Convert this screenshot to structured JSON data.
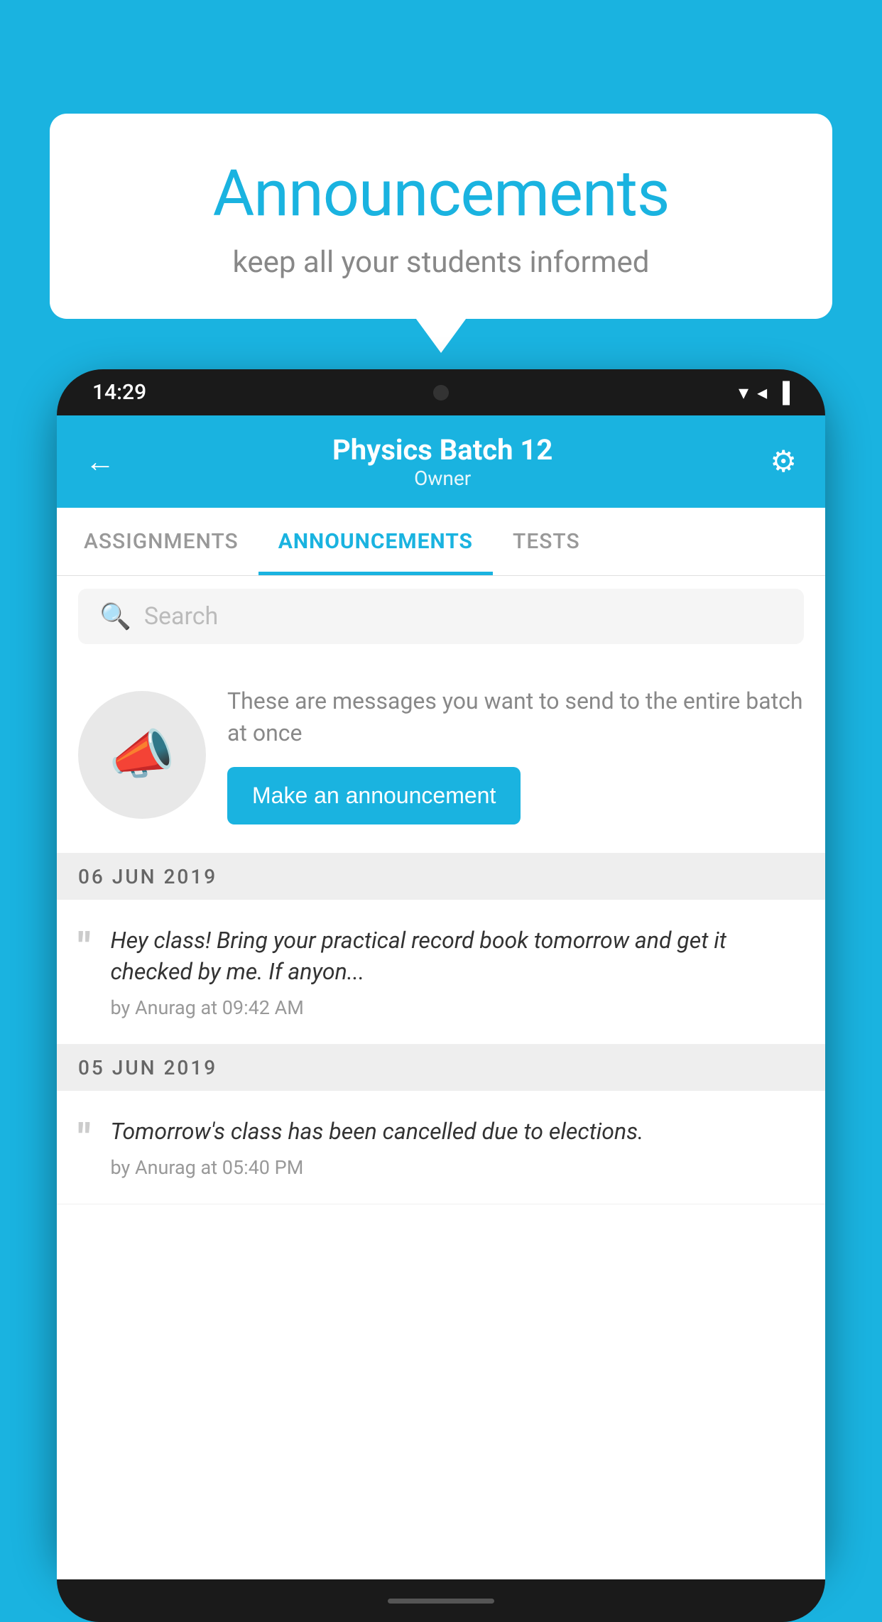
{
  "background_color": "#1ab3e0",
  "speech_bubble": {
    "title": "Announcements",
    "subtitle": "keep all your students informed"
  },
  "phone": {
    "status_bar": {
      "time": "14:29",
      "wifi": "▼",
      "signal": "▲",
      "battery": "▐"
    },
    "header": {
      "title": "Physics Batch 12",
      "subtitle": "Owner",
      "back_label": "←",
      "settings_label": "⚙"
    },
    "tabs": [
      {
        "label": "ASSIGNMENTS",
        "active": false
      },
      {
        "label": "ANNOUNCEMENTS",
        "active": true
      },
      {
        "label": "TESTS",
        "active": false
      }
    ],
    "search": {
      "placeholder": "Search"
    },
    "promo": {
      "description": "These are messages you want to send to the entire batch at once",
      "button_label": "Make an announcement"
    },
    "announcements": [
      {
        "date": "06  JUN  2019",
        "message": "Hey class! Bring your practical record book tomorrow and get it checked by me. If anyon...",
        "meta": "by Anurag at 09:42 AM"
      },
      {
        "date": "05  JUN  2019",
        "message": "Tomorrow's class has been cancelled due to elections.",
        "meta": "by Anurag at 05:40 PM"
      }
    ]
  }
}
